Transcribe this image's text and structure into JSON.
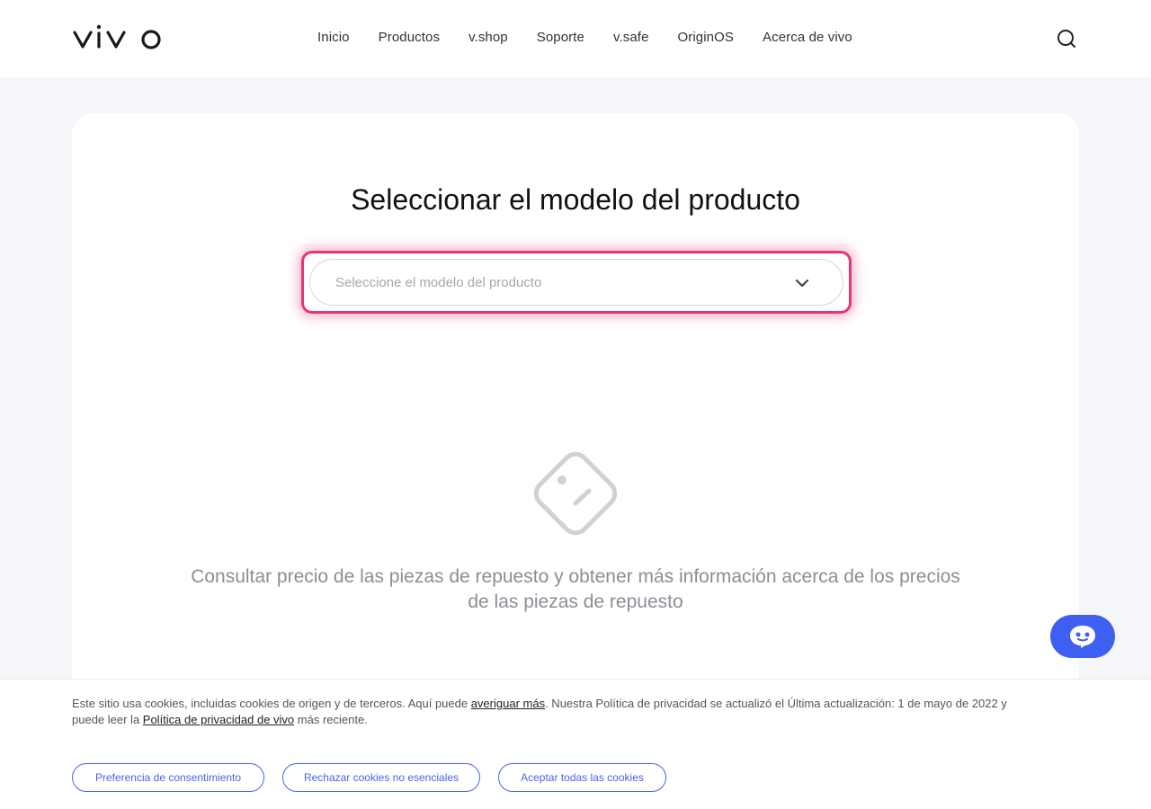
{
  "header": {
    "logo_text": "vivo",
    "nav": [
      {
        "label": "Inicio"
      },
      {
        "label": "Productos"
      },
      {
        "label": "v.shop"
      },
      {
        "label": "Soporte"
      },
      {
        "label": "v.safe"
      },
      {
        "label": "OriginOS"
      },
      {
        "label": "Acerca de vivo"
      }
    ]
  },
  "main": {
    "title": "Seleccionar el modelo del producto",
    "select": {
      "placeholder": "Seleccione el modelo del producto"
    },
    "info_text": "Consultar precio de las piezas de repuesto y obtener más información acerca de los precios de las piezas de repuesto"
  },
  "cookie": {
    "text_part1": "Este sitio usa cookies, incluidas cookies de origen y de terceros. Aquí puede ",
    "link1": "averiguar más",
    "text_part2": ". Nuestra Política de privacidad se actualizó el Última actualización: 1 de mayo de 2022 y puede leer la ",
    "link2": "Política de privacidad de vivo",
    "text_part3": " más reciente.",
    "buttons": {
      "preference": "Preferencia de consentimiento",
      "reject": "Rechazar cookies no esenciales",
      "accept": "Aceptar todas las cookies"
    }
  },
  "colors": {
    "accent_blue": "#3f5ef2",
    "highlight_pink": "#e8356d"
  }
}
